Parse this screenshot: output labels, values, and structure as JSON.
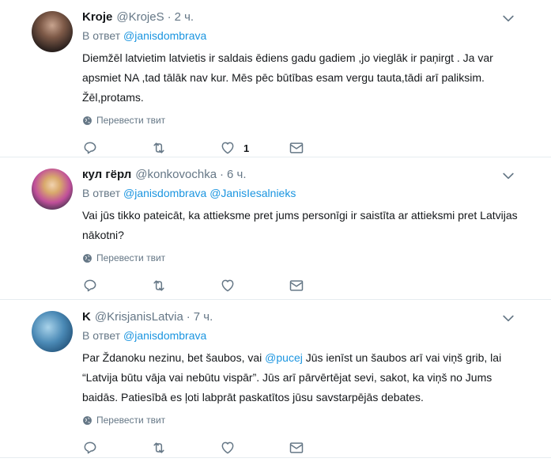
{
  "tweets": [
    {
      "name": "Kroje",
      "handle": "@KrojeS",
      "dot": "·",
      "time": "2 ч.",
      "reply_label": "В ответ",
      "reply_to": [
        "@janisdombrava"
      ],
      "text": "Diemžēl latvietim latvietis ir saldais ēdiens gadu gadiem ,jo vieglāk ir paņirgt . Ja var apsmiet NA ,tad tālāk nav kur. Mēs pēc būtības esam vergu tauta,tādi arī paliksim. Žēl,protams.",
      "translate": "Перевести твит",
      "like_count": "1"
    },
    {
      "name": "кул гёрл",
      "handle": "@konkovochka",
      "dot": "·",
      "time": "6 ч.",
      "reply_label": "В ответ",
      "reply_to": [
        "@janisdombrava",
        "@JanisIesalnieks"
      ],
      "text": "Vai jūs tikko pateicāt, ka attieksme pret jums personīgi ir saistīta ar attieksmi pret Latvijas nākotni?",
      "translate": "Перевести твит",
      "like_count": ""
    },
    {
      "name": "K",
      "handle": "@KrisjanisLatvia",
      "dot": "·",
      "time": "7 ч.",
      "reply_label": "В ответ",
      "reply_to": [
        "@janisdombrava"
      ],
      "text_before": "Par Ždanoku nezinu, bet šaubos, vai ",
      "text_mention": "@pucej",
      "text_after": " Jūs ienīst un šaubos arī vai viņš grib, lai “Latvija būtu vāja vai nebūtu vispār”. Jūs arī pārvērtējat sevi, sakot, ka viņš no Jums baidās. Patiesībā es ļoti labprāt paskatītos jūsu  savstarpējās debates.",
      "translate": "Перевести твит",
      "like_count": ""
    }
  ],
  "colors": {
    "link": "#1b95e0",
    "muted": "#657786",
    "text": "#14171a",
    "border": "#e6ecf0"
  },
  "icons": [
    "avatar",
    "chevron-down-icon",
    "globe-icon",
    "reply-icon",
    "retweet-icon",
    "like-icon",
    "message-icon"
  ]
}
